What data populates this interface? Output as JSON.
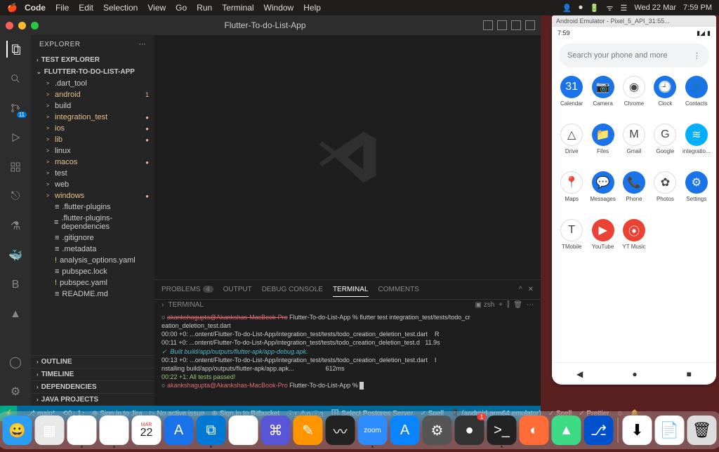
{
  "menubar": {
    "app": "Code",
    "items": [
      "File",
      "Edit",
      "Selection",
      "View",
      "Go",
      "Run",
      "Terminal",
      "Window",
      "Help"
    ],
    "right": {
      "date": "Wed 22 Mar",
      "time": "7:59 PM"
    }
  },
  "vscode": {
    "title": "Flutter-To-do-List-App",
    "explorer": {
      "header": "EXPLORER",
      "sections": {
        "test_explorer": "TEST EXPLORER",
        "project": "FLUTTER-TO-DO-LIST-APP",
        "outline": "OUTLINE",
        "timeline": "TIMELINE",
        "dependencies": "DEPENDENCIES",
        "java_projects": "JAVA PROJECTS"
      },
      "tree": [
        {
          "label": ".dart_tool",
          "chev": ">",
          "modified": false
        },
        {
          "label": "android",
          "chev": ">",
          "modified": true,
          "count": "1"
        },
        {
          "label": "build",
          "chev": ">",
          "modified": false
        },
        {
          "label": "integration_test",
          "chev": ">",
          "modified": true,
          "dot": true
        },
        {
          "label": "ios",
          "chev": ">",
          "modified": true,
          "dot": true
        },
        {
          "label": "lib",
          "chev": ">",
          "modified": true,
          "dot": true
        },
        {
          "label": "linux",
          "chev": ">",
          "modified": false
        },
        {
          "label": "macos",
          "chev": ">",
          "modified": true,
          "dot": true
        },
        {
          "label": "test",
          "chev": ">",
          "modified": false
        },
        {
          "label": "web",
          "chev": ">",
          "modified": false
        },
        {
          "label": "windows",
          "chev": ">",
          "modified": true,
          "dot": true
        },
        {
          "label": ".flutter-plugins",
          "file": true
        },
        {
          "label": ".flutter-plugins-dependencies",
          "file": true
        },
        {
          "label": ".gitignore",
          "file": true
        },
        {
          "label": ".metadata",
          "file": true
        },
        {
          "label": "analysis_options.yaml",
          "file": true,
          "warn": true
        },
        {
          "label": "pubspec.lock",
          "file": true
        },
        {
          "label": "pubspec.yaml",
          "file": true,
          "warn": true
        },
        {
          "label": "README.md",
          "file": true
        }
      ]
    },
    "activitybar": {
      "scm_badge": "11"
    },
    "panel": {
      "tabs": {
        "problems": "PROBLEMS",
        "problems_count": "4",
        "output": "OUTPUT",
        "debug": "DEBUG CONSOLE",
        "terminal": "TERMINAL",
        "comments": "COMMENTS"
      },
      "terminal_label": "TERMINAL",
      "shell": "zsh",
      "lines": [
        {
          "prompt": "akankshagupta@Akankshas-MacBook-Pro",
          "rest": " Flutter-To-do-List-App % flutter test integration_test/tests/todo_cr"
        },
        {
          "plain": "eation_deletion_test.dart"
        },
        {
          "time": "00:00 +0:",
          "rest": " ...ontent/Flutter-To-do-List-App/integration_test/tests/todo_creation_deletion_test.dart    R"
        },
        {
          "time": "00:11 +0:",
          "rest": " ...ontent/Flutter-To-do-List-App/integration_test/tests/todo_creation_deletion_test.d   11.9s"
        },
        {
          "cyan": "✓  Built build/app/outputs/flutter-apk/app-debug.apk."
        },
        {
          "time": "00:13 +0:",
          "rest": " ...ontent/Flutter-To-do-List-App/integration_test/tests/todo_creation_deletion_test.dart    I"
        },
        {
          "plain": "nstalling build/app/outputs/flutter-apk/app.apk...                  612ms"
        },
        {
          "green": "00:22 +1: All tests passed!"
        },
        {
          "prompt2": "akankshagupta@Akankshas-MacBook-Pro",
          "rest2": " Flutter-To-do-List-App % ",
          "cursor": true
        }
      ]
    },
    "statusbar": {
      "branch": "main*",
      "sync": "⟲0↓ 1↑",
      "jira": "Sign in to Jira",
      "issue": "No active issue",
      "bitbucket": "Sign in to Bitbucket",
      "diagnostics": "ⓧ1 ⚠0 ⓘ3",
      "postgres": "Select Postgres Server",
      "spell1": "✓ Spell",
      "device": "(android-arm64 emulator)",
      "spell2": "✓ Spell",
      "prettier": "✓ Prettier"
    }
  },
  "emulator": {
    "window_title": "Android Emulator - Pixel_5_API_31:55...",
    "status_time": "7:59",
    "search_placeholder": "Search your phone and more",
    "apps": [
      {
        "label": "Calendar",
        "glyph": "31",
        "bg": "bg-blue"
      },
      {
        "label": "Camera",
        "glyph": "📷",
        "bg": "bg-blue"
      },
      {
        "label": "Chrome",
        "glyph": "◉",
        "bg": "bg-white"
      },
      {
        "label": "Clock",
        "glyph": "🕘",
        "bg": "bg-blue"
      },
      {
        "label": "Contacts",
        "glyph": "👤",
        "bg": "bg-blue"
      },
      {
        "label": "Drive",
        "glyph": "△",
        "bg": "bg-white"
      },
      {
        "label": "Files",
        "glyph": "📁",
        "bg": "bg-blue"
      },
      {
        "label": "Gmail",
        "glyph": "M",
        "bg": "bg-white"
      },
      {
        "label": "Google",
        "glyph": "G",
        "bg": "bg-white"
      },
      {
        "label": "integratio...",
        "glyph": "≋",
        "bg": "bg-cyan"
      },
      {
        "label": "Maps",
        "glyph": "📍",
        "bg": "bg-white"
      },
      {
        "label": "Messages",
        "glyph": "💬",
        "bg": "bg-blue"
      },
      {
        "label": "Phone",
        "glyph": "📞",
        "bg": "bg-blue"
      },
      {
        "label": "Photos",
        "glyph": "✿",
        "bg": "bg-white"
      },
      {
        "label": "Settings",
        "glyph": "⚙",
        "bg": "bg-blue"
      },
      {
        "label": "TMobile",
        "glyph": "T",
        "bg": "bg-white"
      },
      {
        "label": "YouTube",
        "glyph": "▶",
        "bg": "bg-red"
      },
      {
        "label": "YT Music",
        "glyph": "⦿",
        "bg": "bg-red"
      }
    ]
  },
  "dock": {
    "icons": [
      {
        "name": "finder",
        "glyph": "😀",
        "bg": "#2a9df4"
      },
      {
        "name": "launchpad",
        "glyph": "▦",
        "bg": "#e8e8e8"
      },
      {
        "name": "chrome",
        "glyph": "◉",
        "bg": "#fff",
        "running": true
      },
      {
        "name": "slack",
        "glyph": "✱",
        "bg": "#fff",
        "running": true
      },
      {
        "name": "calendar",
        "glyph": "22",
        "bg": "#fff",
        "sub": "MAR"
      },
      {
        "name": "xcode",
        "glyph": "A",
        "bg": "#1a73e8"
      },
      {
        "name": "vscode",
        "glyph": "⧉",
        "bg": "#0078d4",
        "running": true
      },
      {
        "name": "reminders",
        "glyph": "☰",
        "bg": "#fff"
      },
      {
        "name": "app-store-alt",
        "glyph": "⌘",
        "bg": "#5856d6"
      },
      {
        "name": "pages",
        "glyph": "✎",
        "bg": "#ff9500"
      },
      {
        "name": "activity",
        "glyph": "〰",
        "bg": "#222"
      },
      {
        "name": "zoom",
        "glyph": "zoom",
        "bg": "#2d8cff",
        "running": true,
        "small": true
      },
      {
        "name": "app-store",
        "glyph": "A",
        "bg": "#0a84ff"
      },
      {
        "name": "settings",
        "glyph": "⚙",
        "bg": "#555"
      },
      {
        "name": "notif",
        "glyph": "●",
        "bg": "#333",
        "badge": "1"
      },
      {
        "name": "terminal",
        "glyph": ">_",
        "bg": "#222",
        "running": true
      },
      {
        "name": "postman",
        "glyph": "◐",
        "bg": "#ff6c37"
      },
      {
        "name": "android-studio",
        "glyph": "▲",
        "bg": "#3ddc84"
      },
      {
        "name": "git",
        "glyph": "⎇",
        "bg": "#0052cc"
      }
    ],
    "trash_items": [
      {
        "name": "downloads",
        "glyph": "⬇",
        "bg": "#fff"
      },
      {
        "name": "doc",
        "glyph": "📄",
        "bg": "#fff"
      },
      {
        "name": "trash",
        "glyph": "🗑",
        "bg": "#ddd"
      }
    ]
  }
}
